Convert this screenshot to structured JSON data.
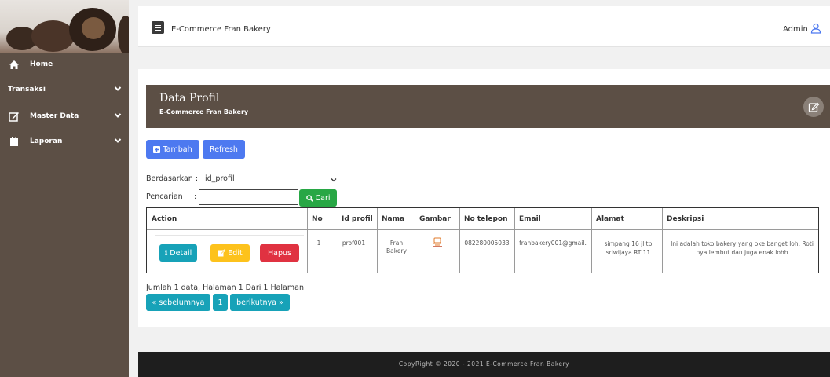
{
  "app": {
    "title": "E-Commerce Fran Bakery",
    "admin_label": "Admin"
  },
  "sidebar": {
    "items": [
      {
        "label": "Home",
        "icon": "home-icon"
      },
      {
        "label": "Transaksi",
        "icon": ""
      },
      {
        "label": "Master Data",
        "icon": "edit-icon"
      },
      {
        "label": "Laporan",
        "icon": "folder-icon"
      }
    ]
  },
  "card": {
    "title": "Data Profil",
    "subtitle": "E-Commerce Fran Bakery"
  },
  "toolbar": {
    "add_label": "Tambah",
    "refresh_label": "Refresh"
  },
  "filter": {
    "by_label": "Berdasarkan :",
    "by_value": "id_profil",
    "search_label": "Pencarian",
    "search_colon": ":",
    "search_value": "",
    "search_button": "Cari"
  },
  "table": {
    "headers": [
      "Action",
      "No",
      "Id profil",
      "Nama",
      "Gambar",
      "No telepon",
      "Email",
      "Alamat",
      "Deskripsi"
    ],
    "rows": [
      {
        "detail_label": "Detail",
        "edit_label": "Edit",
        "delete_label": "Hapus",
        "no": "1",
        "id_profil": "prof001",
        "nama": "Fran Bakery",
        "gambar": "bakery-logo-icon",
        "telepon": "082280005033",
        "email": "franbakery001@gmail.",
        "alamat": "simpang 16 jl.tp sriwijaya RT 11",
        "deskripsi": "Ini adalah toko bakery yang oke banget loh. Roti nya lembut dan juga enak lohh"
      }
    ]
  },
  "pagination": {
    "info": "Jumlah 1 data, Halaman 1 Dari 1 Halaman",
    "prev_label": "« sebelumnya",
    "current_page": "1",
    "next_label": "berikutnya »"
  },
  "footer": {
    "text": "CopyRight © 2020 - 2021 E-Commerce Fran Bakery"
  },
  "colors": {
    "brown": "#5c4f45",
    "blue": "#4d79f0",
    "info": "#17a2b8",
    "warning": "#fdc21c",
    "danger": "#e03241",
    "success": "#28a745",
    "footer": "#1e1e1e"
  }
}
